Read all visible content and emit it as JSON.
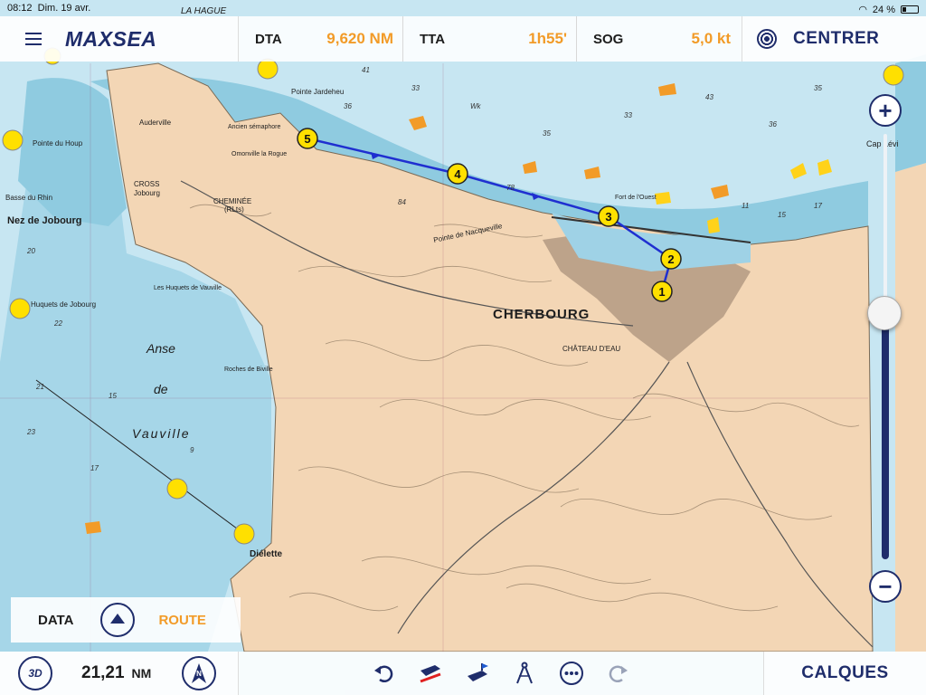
{
  "status": {
    "time": "08:12",
    "date": "Dim. 19 avr.",
    "battery": "24 %"
  },
  "topbar": {
    "logo": "MAXSEA",
    "menu_icon": "hamburger-menu-icon",
    "metrics": [
      {
        "label": "DTA",
        "value": "9,620 NM"
      },
      {
        "label": "TTA",
        "value": "1h55'"
      },
      {
        "label": "SOG",
        "value": "5,0 kt"
      }
    ],
    "center_label": "CENTRER",
    "accent_color": "#f29b28",
    "brand_color": "#1f2d6b"
  },
  "zoom": {
    "plus": "+",
    "minus": "−",
    "level": 0.56
  },
  "panel": {
    "data_label": "DATA",
    "route_label": "ROUTE"
  },
  "bottombar": {
    "mode_3d": "3D",
    "distance_value": "21,21",
    "distance_unit": "NM",
    "north_label": "N",
    "layers_label": "CALQUES"
  },
  "map": {
    "place_labels": {
      "cherbourg": "CHERBOURG",
      "nez_jobourg": "Nez de Jobourg",
      "anse": "Anse",
      "de": "de",
      "vauville": "Vauville",
      "dielette": "Diélette",
      "huquets": "Huquets de Jobourg",
      "auderville": "Auderville",
      "cross": "CROSS",
      "jobourg": "Jobourg",
      "cheminee": "CHEMINÉE",
      "rlts": "(RLts)",
      "pointe_hogue": "Pointe du Houp",
      "basse_rhin": "Basse du Rhin",
      "omonville": "Omonville la Rogue",
      "semaphore": "Ancien sémaphore",
      "pointe_jardeheu": "Pointe Jardeheu",
      "pointe_nacqueville": "Pointe de Nacqueville",
      "chateau_eau": "CHÂTEAU D'EAU",
      "cap_levi": "Cap Lévi",
      "roches_biville": "Roches de Biville",
      "huquets_vauville": "Les Huquets de Vauville",
      "fort_ouest": "Fort de l'Ouest",
      "le_hague": "LA HAGUE"
    },
    "route_points": [
      "1",
      "2",
      "3",
      "4",
      "5"
    ]
  }
}
